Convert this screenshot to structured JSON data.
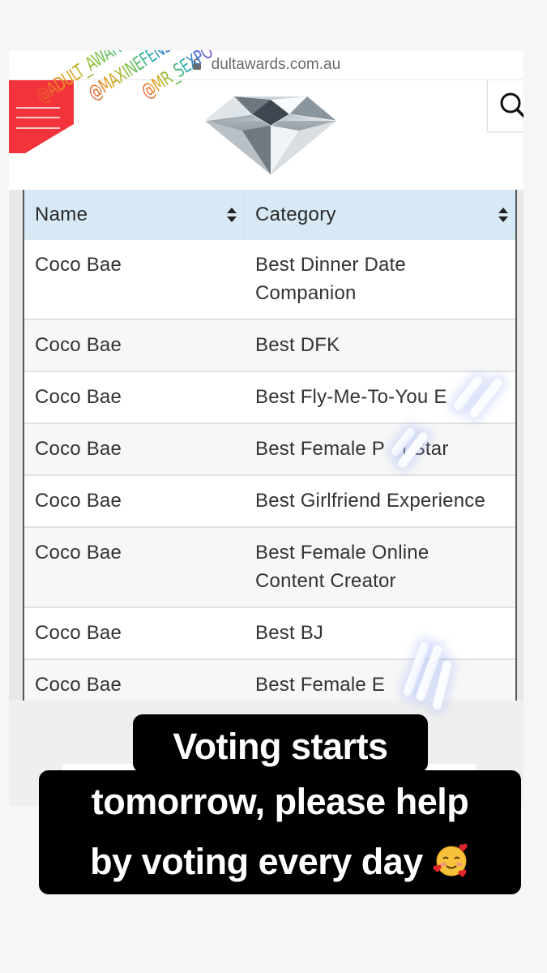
{
  "browser": {
    "url": "adultawards.com.au",
    "url_visible": " dultawards.com.au",
    "lock_icon": "lock-icon"
  },
  "site_header": {
    "menu_icon": "hamburger-menu-icon",
    "logo": "diamond-logo",
    "search_icon": "search-icon",
    "colors": {
      "menu_bg": "#f2333b",
      "header_bg": "#ffffff"
    }
  },
  "overlay_handles": [
    "@ADULT_AWARDS_OFFICIAL",
    "@MAXINEFENSOM",
    "@MR_SEXPO"
  ],
  "table": {
    "columns": [
      {
        "label": "Name",
        "sort_icon": "sort-icon"
      },
      {
        "label": "Category",
        "sort_icon": "sort-icon"
      }
    ],
    "rows": [
      {
        "name": "Coco Bae",
        "category": "Best Dinner Date Companion"
      },
      {
        "name": "Coco Bae",
        "category": "Best DFK"
      },
      {
        "name": "Coco Bae",
        "category": "Best Fly-Me-To-You E"
      },
      {
        "name": "Coco Bae",
        "category": "Best Female P  n Star"
      },
      {
        "name": "Coco Bae",
        "category": "Best Girlfriend Experience"
      },
      {
        "name": "Coco Bae",
        "category": "Best Female Online Content Creator"
      },
      {
        "name": "Coco Bae",
        "category": "Best BJ"
      },
      {
        "name": "Coco Bae",
        "category": "Best Female E"
      }
    ],
    "colors": {
      "header_bg": "#d6e9f5",
      "row_alt_bg": "#f7f7f7"
    }
  },
  "caption": {
    "line1": "Voting starts",
    "line2": "tomorrow, please help",
    "line3": "by voting every day",
    "emoji": "smiling-face-with-hearts-emoji"
  }
}
